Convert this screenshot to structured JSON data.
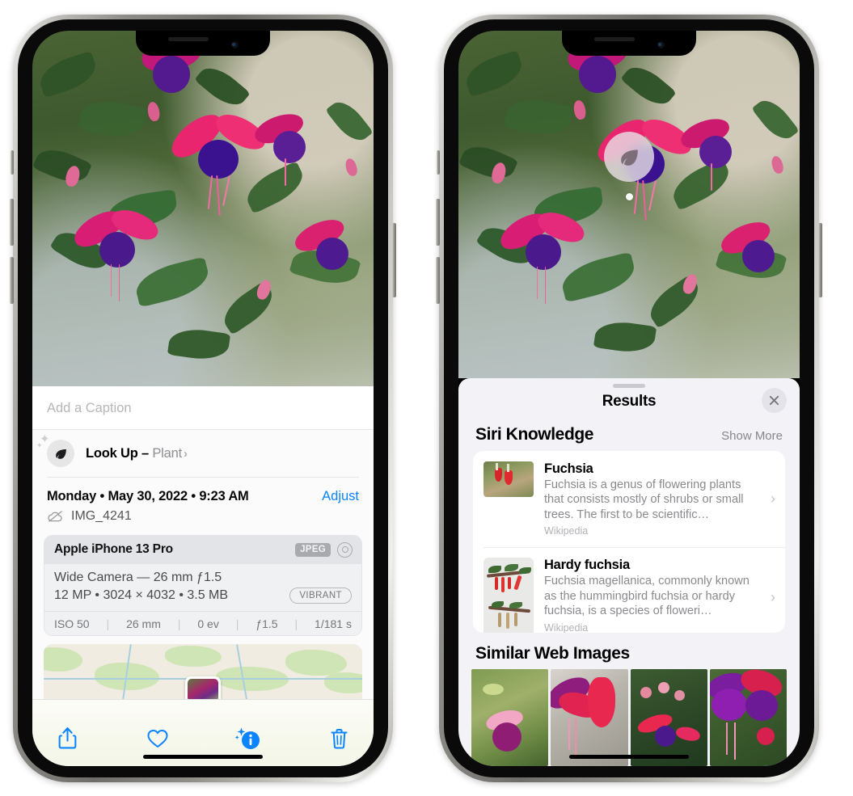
{
  "left_phone": {
    "name": "iphone-photo-info",
    "caption": {
      "placeholder": "Add a Caption"
    },
    "lookup": {
      "icon": "leaf-icon",
      "label": "Look Up – ",
      "subject": "Plant",
      "chevron": "›"
    },
    "meta": {
      "date": "Monday • May 30, 2022 • 9:23 AM",
      "adjust_label": "Adjust",
      "cloud_icon": "cloud-slash-icon",
      "filename": "IMG_4241"
    },
    "exif": {
      "device": "Apple iPhone 13 Pro",
      "format_badge": "JPEG",
      "lens_icon": "aperture-icon",
      "lens_line": "Wide Camera — 26 mm ƒ1.5",
      "size_line": "12 MP • 3024 × 4032 • 3.5 MB",
      "vibrant_badge": "VIBRANT",
      "stats": [
        "ISO 50",
        "26 mm",
        "0 ev",
        "ƒ1.5",
        "1/181 s"
      ]
    },
    "toolbar": {
      "share": "share-icon",
      "favorite": "heart-icon",
      "info": "info-sparkle-icon",
      "delete": "trash-icon"
    }
  },
  "right_phone": {
    "name": "iphone-visual-lookup-results",
    "pin": {
      "icon": "leaf-icon"
    },
    "sheet": {
      "title": "Results",
      "close_icon": "close-icon"
    },
    "siri_knowledge": {
      "title": "Siri Knowledge",
      "show_more": "Show More",
      "cards": [
        {
          "title": "Fuchsia",
          "description": "Fuchsia is a genus of flowering plants that consists mostly of shrubs or small trees. The first to be scientific…",
          "source": "Wikipedia",
          "chevron": "›"
        },
        {
          "title": "Hardy fuchsia",
          "description": "Fuchsia magellanica, commonly known as the hummingbird fuchsia or hardy fuchsia, is a species of floweri…",
          "source": "Wikipedia",
          "chevron": "›"
        }
      ]
    },
    "similar_web_images": {
      "title": "Similar Web Images",
      "count": 4
    }
  },
  "colors": {
    "accent_blue": "#0a84ff",
    "sheet_bg": "#f3f2f7",
    "panel_bg": "#fbfbfb",
    "muted_text": "#8a8a8e"
  }
}
